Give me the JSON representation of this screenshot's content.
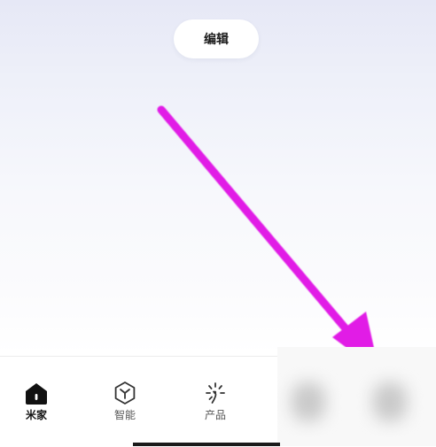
{
  "header": {
    "edit_label": "编辑"
  },
  "annotation": {
    "arrow_color": "#e11ee6",
    "arrow_icon": "pointing-arrow-icon"
  },
  "bottom_nav": {
    "tabs": [
      {
        "label": "米家",
        "icon": "home-icon",
        "active": true
      },
      {
        "label": "智能",
        "icon": "smart-hexagon-icon",
        "active": false
      },
      {
        "label": "产品",
        "icon": "sparkle-icon",
        "active": false
      }
    ],
    "active_color": "#111111",
    "inactive_color": "#555555"
  }
}
